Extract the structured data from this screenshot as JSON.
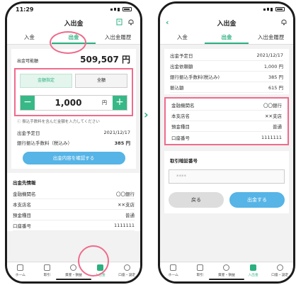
{
  "left": {
    "time": "11:29",
    "title": "入出金",
    "tabs": [
      "入金",
      "出金",
      "入出金履歴"
    ],
    "available_label": "出金可能額",
    "available_value": "509,507 円",
    "seg_specified": "金額指定",
    "seg_all": "全額",
    "amount": "1,000",
    "yen": "円",
    "note": "ⓘ 振込手数料を含んだ金額を入力してください",
    "date_label": "出金予定日",
    "date_value": "2021/12/17",
    "fee_label": "銀行振込手数料（税込み）",
    "fee_value": "385 円",
    "confirm_btn": "出金内容を確認する",
    "dest_title": "出金先情報",
    "dest_rows": [
      {
        "k": "金融機関名",
        "v": "〇〇銀行"
      },
      {
        "k": "本支店名",
        "v": "✕✕支店"
      },
      {
        "k": "預金種目",
        "v": "普通"
      },
      {
        "k": "口座番号",
        "v": "1111111"
      }
    ],
    "tabbar": [
      "ホーム",
      "取引",
      "資産・損益",
      "入出金",
      "口座・設定"
    ]
  },
  "right": {
    "title": "入出金",
    "tabs": [
      "入金",
      "出金",
      "入出金履歴"
    ],
    "info_rows": [
      {
        "k": "出金予定日",
        "v": "2021/12/17"
      },
      {
        "k": "出金依頼額",
        "v": "1,000 円"
      },
      {
        "k": "銀行振込手数料(税込み)",
        "v": "385 円"
      },
      {
        "k": "振込額",
        "v": "615 円"
      }
    ],
    "bank_rows": [
      {
        "k": "金融機関名",
        "v": "〇〇銀行"
      },
      {
        "k": "本支店名",
        "v": "✕✕支店"
      },
      {
        "k": "預金種目",
        "v": "普通"
      },
      {
        "k": "口座番号",
        "v": "1111111"
      }
    ],
    "pin_title": "取引暗証番号",
    "pin_placeholder": "****",
    "back_btn": "戻る",
    "submit_btn": "出金する",
    "tabbar": [
      "ホーム",
      "取引",
      "資産・損益",
      "入出金",
      "口座・設定"
    ]
  },
  "colors": {
    "accent": "#2bb07f",
    "highlight": "#ef6b8c",
    "button": "#56b4e6"
  }
}
